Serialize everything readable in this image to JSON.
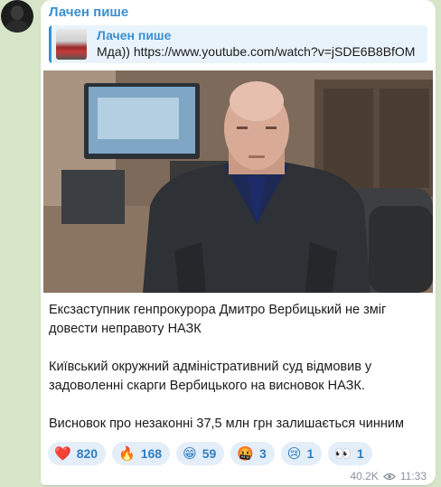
{
  "channel": {
    "author": "Лачен пише"
  },
  "reply": {
    "author": "Лачен пише",
    "text": "Мда)) https://www.youtube.com/watch?v=jSDE6B8BfOM"
  },
  "message": {
    "paragraphs": [
      "Екс­заступник генпрокурора Дмитро Вербицький не зміг довести неправоту НАЗК",
      "Київський окружний адміністративний суд відмовив у задоволенні скарги Вербицького на висновок НАЗК.",
      "Висновок про незаконні 37,5 млн грн залишається чинним"
    ]
  },
  "reactions": [
    {
      "emoji": "❤️",
      "icon": "heart-icon",
      "count": "820"
    },
    {
      "emoji": "🔥",
      "icon": "fire-icon",
      "count": "168"
    },
    {
      "emoji": "😁",
      "icon": "grin-icon",
      "count": "59"
    },
    {
      "emoji": "🤬",
      "icon": "angry-icon",
      "count": "3"
    },
    {
      "emoji": "😢",
      "icon": "crying-icon",
      "count": "1"
    },
    {
      "emoji": "👀",
      "icon": "eyes-icon",
      "count": "1"
    }
  ],
  "meta": {
    "views": "40.2K",
    "time": "11:33"
  },
  "colors": {
    "accent": "#3a8fd0",
    "background": "#d6e4c8"
  }
}
